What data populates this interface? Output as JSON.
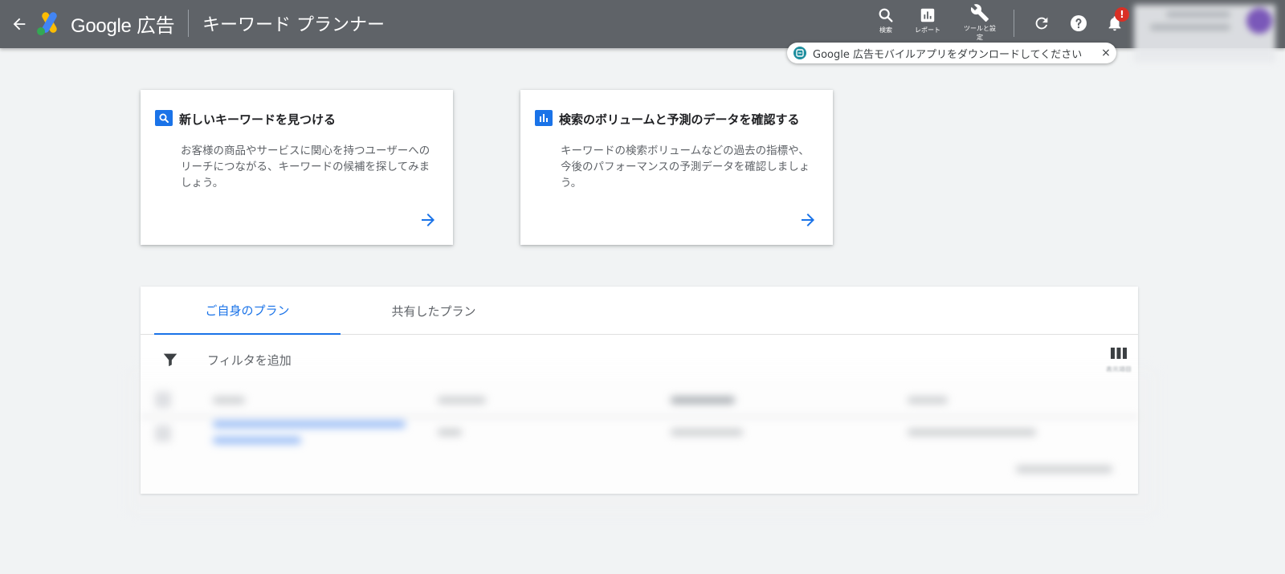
{
  "header": {
    "brand": "Google 広告",
    "page_title": "キーワード プランナー",
    "tools": {
      "search_label": "検索",
      "report_label": "レポート",
      "settings_label": "ツールと設定"
    },
    "notification_badge": "!"
  },
  "toast": {
    "text": "Google 広告モバイルアプリをダウンロードしてください",
    "close": "×"
  },
  "cards": [
    {
      "title": "新しいキーワードを見つける",
      "description": "お客様の商品やサービスに関心を持つユーザーへのリーチにつながる、キーワードの候補を探してみましょう。"
    },
    {
      "title": "検索のボリュームと予測のデータを確認する",
      "description": "キーワードの検索ボリュームなどの過去の指標や、今後のパフォーマンスの予測データを確認しましょう。"
    }
  ],
  "plans": {
    "tabs": [
      "ご自身のプラン",
      "共有したプラン"
    ],
    "active_tab": 0,
    "filter_label": "フィルタを追加",
    "columns_label": "表示項目"
  },
  "colors": {
    "header_bg": "#5f6368",
    "accent": "#1a73e8",
    "page_bg": "#f1f3f4",
    "badge": "#d93025"
  }
}
